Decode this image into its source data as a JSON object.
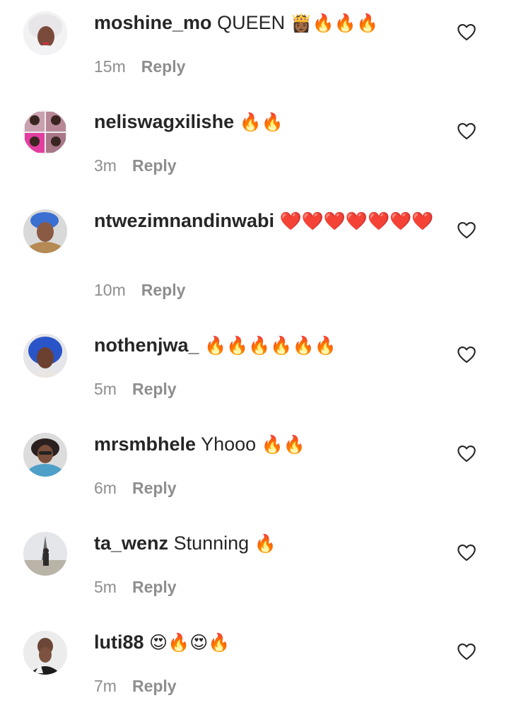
{
  "comments": [
    {
      "username": "moshine_mo",
      "text": "QUEEN",
      "emoji": "👸🏾🔥🔥🔥",
      "time": "15m",
      "reply": "Reply",
      "avatar": "avatar-woman-white-headwrap"
    },
    {
      "username": "neliswagxilishe",
      "text": "",
      "emoji": "🔥🔥",
      "time": "3m",
      "reply": "Reply",
      "avatar": "avatar-photo-collage"
    },
    {
      "username": "ntwezimnandinwabi",
      "text": "",
      "emoji": "❤️❤️❤️❤️❤️❤️❤️",
      "time": "10m",
      "reply": "Reply",
      "avatar": "avatar-woman-blue-hair"
    },
    {
      "username": "nothenjwa_",
      "text": "",
      "emoji": "🔥🔥🔥🔥🔥🔥",
      "time": "5m",
      "reply": "Reply",
      "avatar": "avatar-woman-blue-braids"
    },
    {
      "username": "mrsmbhele",
      "text": "Yhooo",
      "emoji": "🔥🔥",
      "time": "6m",
      "reply": "Reply",
      "avatar": "avatar-woman-glasses"
    },
    {
      "username": "ta_wenz",
      "text": "Stunning",
      "emoji": "🔥",
      "time": "5m",
      "reply": "Reply",
      "avatar": "avatar-eiffel-tower"
    },
    {
      "username": "luti88",
      "text": "",
      "emoji": "😍🔥😍🔥",
      "time": "7m",
      "reply": "Reply",
      "avatar": "avatar-woman-short-hair"
    }
  ],
  "icons": {
    "like": "heart-outline-icon"
  },
  "colors": {
    "text": "#262626",
    "meta": "#8e8e8e",
    "fire": "#f7a21b",
    "heart": "#e0162b"
  }
}
